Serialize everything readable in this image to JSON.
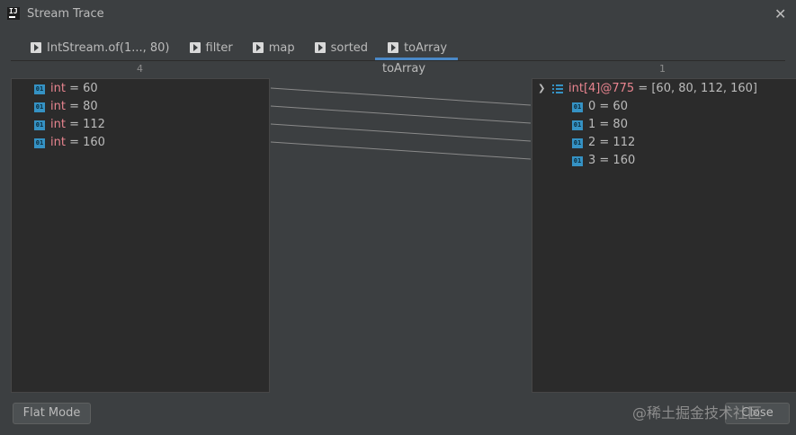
{
  "window": {
    "title": "Stream Trace",
    "close_icon": "close-icon"
  },
  "tabs": [
    {
      "label": "IntStream.of(1..., 80)"
    },
    {
      "label": "filter"
    },
    {
      "label": "map"
    },
    {
      "label": "sorted"
    },
    {
      "label": "toArray",
      "active": true
    }
  ],
  "columns": {
    "left_count": "4",
    "middle_title": "toArray",
    "right_count": "1"
  },
  "left_items": [
    {
      "type": "int",
      "sep": " = ",
      "value": "60"
    },
    {
      "type": "int",
      "sep": " = ",
      "value": "80"
    },
    {
      "type": "int",
      "sep": " = ",
      "value": "112"
    },
    {
      "type": "int",
      "sep": " = ",
      "value": "160"
    }
  ],
  "right_tree": {
    "root_name": "int[4]@775",
    "root_value": " = [60, 80, 112, 160]",
    "children": [
      {
        "text": "0 = 60"
      },
      {
        "text": "1 = 80"
      },
      {
        "text": "2 = 112"
      },
      {
        "text": "3 = 160"
      }
    ]
  },
  "buttons": {
    "flat_mode": "Flat Mode",
    "close": "Close"
  },
  "watermark": "@稀土掘金技术社区",
  "colors": {
    "accent": "#4a88c7",
    "keyword": "#e8848f",
    "primitive_icon": "#3592c4"
  }
}
